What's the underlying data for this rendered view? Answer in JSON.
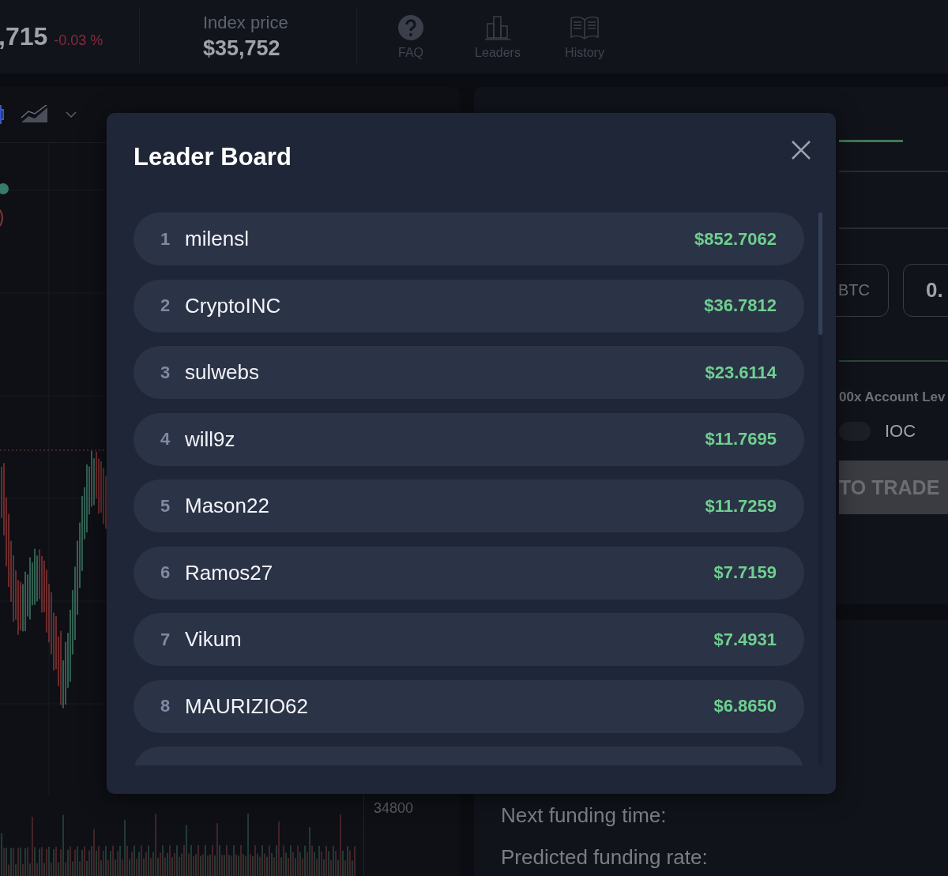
{
  "ticker": {
    "last_price": ",715",
    "change": "-0.03 %"
  },
  "index": {
    "label": "Index price",
    "value": "$35,752"
  },
  "nav": [
    {
      "label": "FAQ",
      "kind": "faq"
    },
    {
      "label": "Leaders",
      "kind": "leaders"
    },
    {
      "label": "History",
      "kind": "history"
    }
  ],
  "chart": {
    "axis_label": "34800"
  },
  "order_panel": {
    "amount_unit": "BTC",
    "amount_value": "0.",
    "leverage_text": "00x Account Lev",
    "option": {
      "label": "IOC",
      "on": false
    },
    "submit": "TO TRADE"
  },
  "funding": [
    "Next funding time:",
    "Predicted funding rate:"
  ],
  "modal": {
    "title": "Leader Board",
    "rows": [
      {
        "rank": "1",
        "name": "milensl",
        "amount": "$852.7062"
      },
      {
        "rank": "2",
        "name": "CryptoINC",
        "amount": "$36.7812"
      },
      {
        "rank": "3",
        "name": "sulwebs",
        "amount": "$23.6114"
      },
      {
        "rank": "4",
        "name": "will9z",
        "amount": "$11.7695"
      },
      {
        "rank": "5",
        "name": "Mason22",
        "amount": "$11.7259"
      },
      {
        "rank": "6",
        "name": "Ramos27",
        "amount": "$7.7159"
      },
      {
        "rank": "7",
        "name": "Vikum",
        "amount": "$7.4931"
      },
      {
        "rank": "8",
        "name": "MAURIZIO62",
        "amount": "$6.8650"
      }
    ]
  }
}
